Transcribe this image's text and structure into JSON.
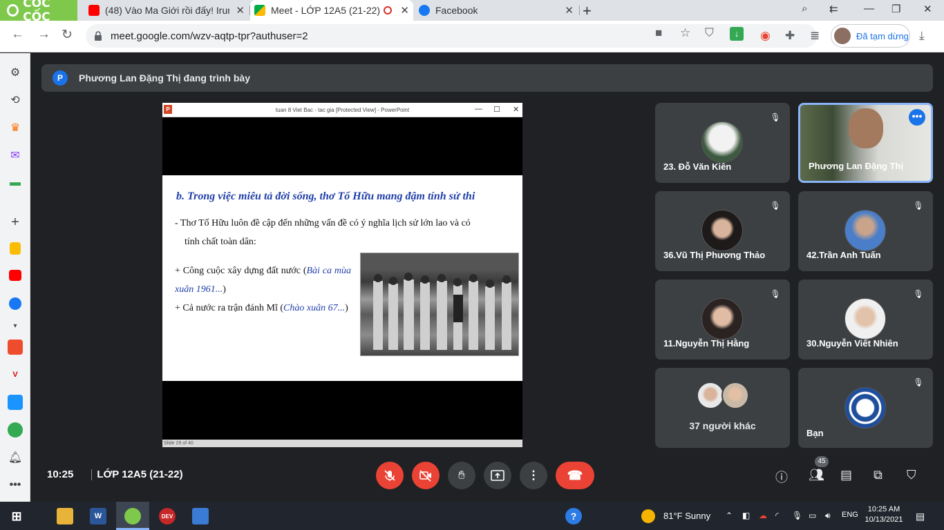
{
  "browser": {
    "brand": "CỐC CỐC",
    "tabs": [
      {
        "title": "(48) Vào Ma Giới rồi đấy! Irur"
      },
      {
        "title": "Meet - LỚP 12A5 (21-22)",
        "active": true
      },
      {
        "title": "Facebook"
      }
    ],
    "url": "meet.google.com/wzv-aqtp-tpr?authuser=2",
    "paused_label": "Đã tạm dừng"
  },
  "meet": {
    "presenter_initial": "P",
    "presenting_text": "Phương Lan Đặng Thị đang trình bày",
    "clock": "10:25",
    "meeting_name": "LỚP 12A5 (21-22)",
    "participant_count": "45",
    "participants": [
      {
        "name": "23. Đỗ Văn Kiên",
        "muted": true
      },
      {
        "name": "Phương Lan Đặng Thị",
        "speaking": true
      },
      {
        "name": "36.Vũ Thị Phương Thảo",
        "muted": true
      },
      {
        "name": "42.Trần Anh Tuấn",
        "muted": true
      },
      {
        "name": "11.Nguyễn Thị Hằng",
        "muted": true
      },
      {
        "name": "30.Nguyễn Viết Nhiên",
        "muted": true
      },
      {
        "name": "37 người khác"
      },
      {
        "name": "Bạn",
        "muted": true
      }
    ]
  },
  "presentation": {
    "window_title": "tuan 8 Viet Bac - tac gia [Protected View] - PowerPoint",
    "slide_title": "b. Trong việc miêu tả đời sống, thơ Tố Hữu mang đậm tính sử thi",
    "bullet1_a": "-  Thơ Tố Hữu luôn đề cập đến những vấn đề có ý nghĩa lịch sử lớn lao và có",
    "bullet1_b": "tính chất toàn dân:",
    "item1_text": "+ Công cuộc xây dựng đất nước (",
    "item1_it": "Bài ca mùa xuân 1961",
    "item1_end": "...)",
    "item2_text": "+ Cả nước ra trận đánh Mĩ (",
    "item2_it": "Chào xuân 67",
    "item2_end": "...)",
    "status": "Slide 29 of 40"
  },
  "taskbar": {
    "weather": "81°F  Sunny",
    "lang": "ENG",
    "time": "10:25 AM",
    "date": "10/13/2021"
  },
  "colors": {
    "meet_bg": "#202124",
    "tile_bg": "#3c4043",
    "end_call": "#ea4335",
    "accent": "#1a73e8",
    "slide_title": "#1f3ea8"
  }
}
